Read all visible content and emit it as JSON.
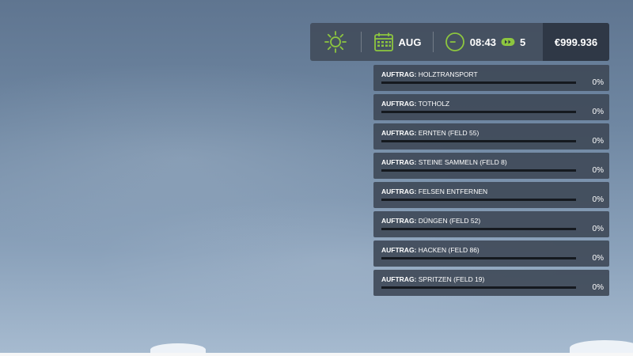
{
  "hud": {
    "weather_icon": "sun-icon",
    "calendar_icon": "calendar-icon",
    "month": "AUG",
    "clock_icon": "clock-icon",
    "time": "08:43",
    "speed_icon": "time-speed-icon",
    "time_scale": "5",
    "money": "€999.936",
    "accent_color": "#8dc63f"
  },
  "jobs": [
    {
      "prefix": "AUFTRAG:",
      "name": "HOLZTRANSPORT",
      "progress_percent": 0,
      "progress_label": "0%"
    },
    {
      "prefix": "AUFTRAG:",
      "name": "TOTHOLZ",
      "progress_percent": 0,
      "progress_label": "0%"
    },
    {
      "prefix": "AUFTRAG:",
      "name": "ERNTEN (FELD 55)",
      "progress_percent": 0,
      "progress_label": "0%"
    },
    {
      "prefix": "AUFTRAG:",
      "name": "STEINE SAMMELN (FELD 8)",
      "progress_percent": 0,
      "progress_label": "0%"
    },
    {
      "prefix": "AUFTRAG:",
      "name": "FELSEN ENTFERNEN",
      "progress_percent": 0,
      "progress_label": "0%"
    },
    {
      "prefix": "AUFTRAG:",
      "name": "DÜNGEN (FELD 52)",
      "progress_percent": 0,
      "progress_label": "0%"
    },
    {
      "prefix": "AUFTRAG:",
      "name": "HACKEN (FELD 86)",
      "progress_percent": 0,
      "progress_label": "0%"
    },
    {
      "prefix": "AUFTRAG:",
      "name": "SPRITZEN (FELD 19)",
      "progress_percent": 0,
      "progress_label": "0%"
    }
  ]
}
